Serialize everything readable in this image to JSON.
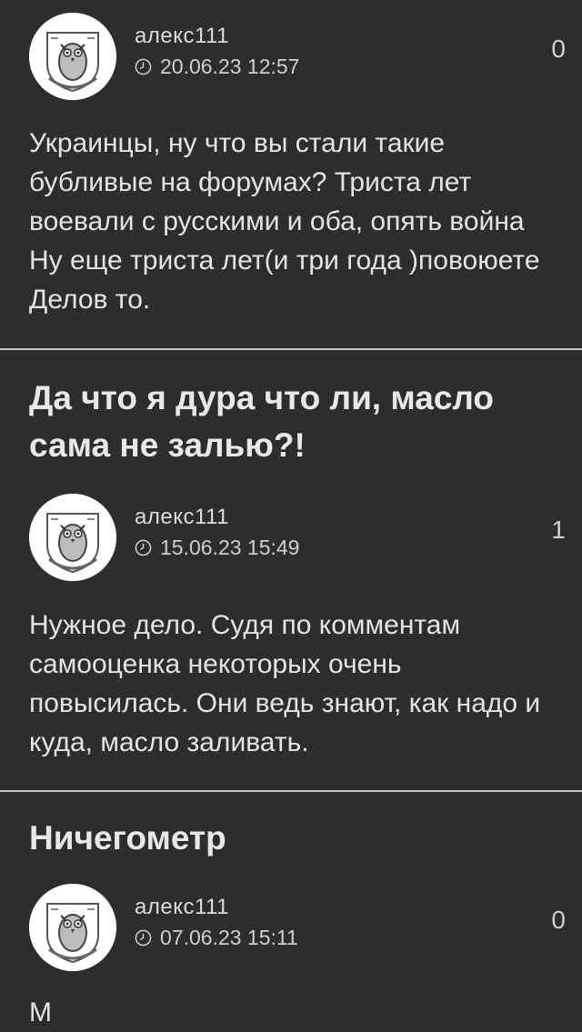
{
  "posts": [
    {
      "title": "",
      "comment": {
        "author": "алекс111",
        "date": "20.06.23 12:57",
        "rating": "0",
        "text": "Украинцы, ну что вы стали такие\nбубливые на форумах? Триста лет\nвоевали с русскими и оба, опять война\nНу еще триста лет(и три года )повоюете\nДелов то."
      }
    },
    {
      "title": "Да что я дура что ли, масло\nсама не залью?!",
      "comment": {
        "author": "алекс111",
        "date": "15.06.23 15:49",
        "rating": "1",
        "text": "Нужное дело. Судя по комментам\nсамооценка некоторых очень\nповысилась. Они ведь знают, как надо и\nкуда, масло заливать."
      }
    },
    {
      "title": "Ничегометр",
      "comment": {
        "author": "алекс111",
        "date": "07.06.23 15:11",
        "rating": "0",
        "text": "М"
      }
    }
  ],
  "icons": {
    "avatar": "owl-crest-avatar",
    "date": "clock-icon"
  },
  "colors": {
    "background": "#2d2d2d",
    "divider": "#c8c8c8",
    "text": "#e4e4e4"
  }
}
